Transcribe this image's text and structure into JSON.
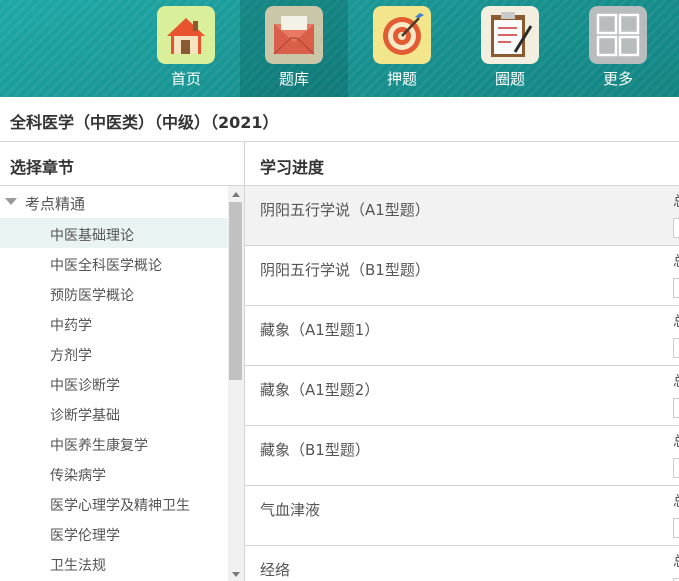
{
  "nav": [
    {
      "label": "首页",
      "icon": "home-icon"
    },
    {
      "label": "题库",
      "icon": "mail-icon"
    },
    {
      "label": "押题",
      "icon": "target-icon"
    },
    {
      "label": "圈题",
      "icon": "clipboard-icon"
    },
    {
      "label": "更多",
      "icon": "grid-icon"
    }
  ],
  "title": "全科医学（中医类）（中级）（2021）",
  "left": {
    "header": "选择章节",
    "root": "考点精通",
    "items": [
      "中医基础理论",
      "中医全科医学概论",
      "预防医学概论",
      "中药学",
      "方剂学",
      "中医诊断学",
      "诊断学基础",
      "中医养生康复学",
      "传染病学",
      "医学心理学及精神卫生",
      "医学伦理学",
      "卫生法规"
    ]
  },
  "right": {
    "header": "学习进度",
    "topics": [
      "阴阳五行学说（A1型题）",
      "阴阳五行学说（B1型题）",
      "藏象（A1型题1）",
      "藏象（A1型题2）",
      "藏象（B1型题）",
      "气血津液",
      "经络"
    ],
    "side_text": "总"
  },
  "colors": {
    "nav_bg": "#17918f",
    "active_row": "#e9f3f4"
  }
}
